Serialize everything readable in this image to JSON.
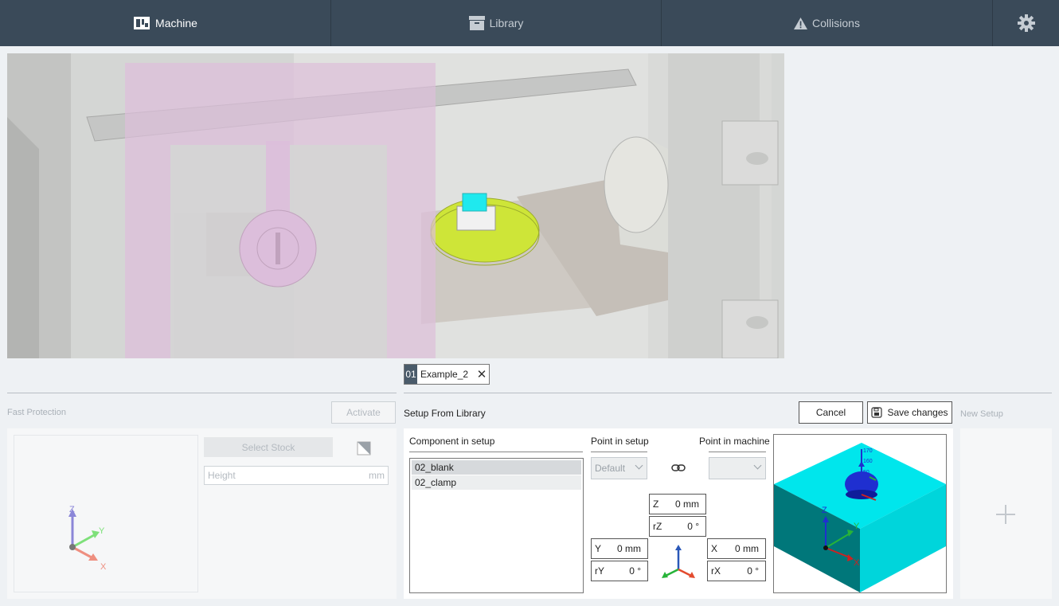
{
  "nav": {
    "machine": "Machine",
    "library": "Library",
    "collisions": "Collisions",
    "machine_icon": "machine-icon",
    "library_icon": "library-icon",
    "collisions_icon": "warning-icon",
    "settings_icon": "gear-icon"
  },
  "setup_tab": {
    "number": "01",
    "name": "Example_2"
  },
  "fast_protection": {
    "title": "Fast Protection",
    "activate": "Activate",
    "select_stock": "Select Stock",
    "height_placeholder": "Height",
    "height_unit": "mm",
    "axes": {
      "z": "Z",
      "y": "Y",
      "x": "X"
    }
  },
  "setup_from_library": {
    "title": "Setup From Library",
    "cancel": "Cancel",
    "save_changes": "Save changes",
    "component_header": "Component in setup",
    "components": [
      "02_blank",
      "02_clamp"
    ],
    "point_in_setup_header": "Point in setup",
    "point_in_machine_header": "Point in machine",
    "point_in_setup_value": "Default",
    "point_in_machine_value": "",
    "z_label": "Z",
    "z_value": "0 mm",
    "rz_label": "rZ",
    "rz_value": "0 °",
    "y_label": "Y",
    "y_value": "0 mm",
    "ry_label": "rY",
    "ry_value": "0 °",
    "x_label": "X",
    "x_value": "0 mm",
    "rx_label": "rX",
    "rx_value": "0 °",
    "preview_scale": [
      "170",
      "160",
      "50"
    ],
    "preview_axes": {
      "z": "Z",
      "y": "Y",
      "x": "X"
    }
  },
  "new_setup": {
    "title": "New Setup"
  },
  "colors": {
    "nav_bg": "#3a4a59",
    "accent_green": "#c8e21d",
    "cyan_block": "#00e6ec",
    "clamp_pink": "#d8b6d6"
  }
}
